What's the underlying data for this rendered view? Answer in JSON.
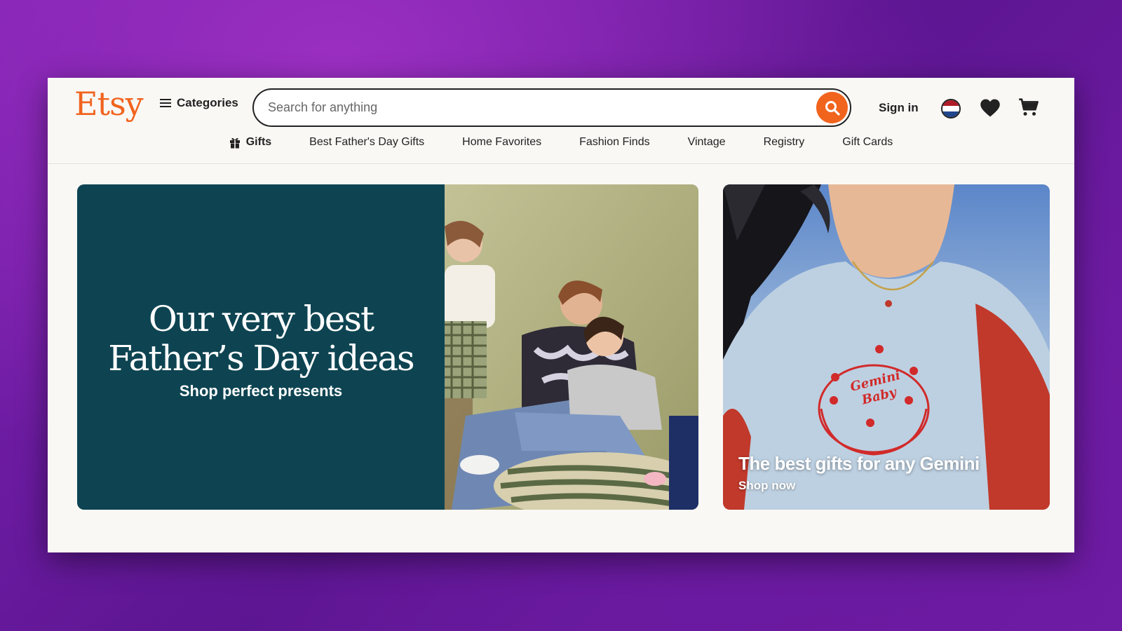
{
  "header": {
    "logo": "Etsy",
    "categories_label": "Categories",
    "search_placeholder": "Search for anything",
    "signin_label": "Sign in",
    "flag_colors": [
      "#ae1c28",
      "#ffffff",
      "#21468b"
    ]
  },
  "nav": {
    "items": [
      {
        "label": "Gifts",
        "icon": "gift-icon"
      },
      {
        "label": "Best Father's Day Gifts"
      },
      {
        "label": "Home Favorites"
      },
      {
        "label": "Fashion Finds"
      },
      {
        "label": "Vintage"
      },
      {
        "label": "Registry"
      },
      {
        "label": "Gift Cards"
      }
    ]
  },
  "hero": {
    "title": "Our very best\nFather’s Day ideas",
    "subtitle": "Shop perfect presents",
    "background_color": "#0e4452"
  },
  "side_banner": {
    "title": "The best gifts for any Gemini",
    "subtitle": "Shop now",
    "shirt_text": "Gemini Baby"
  },
  "colors": {
    "brand": "#f1641e",
    "page_bg": "#f9f8f5",
    "text": "#222222"
  }
}
